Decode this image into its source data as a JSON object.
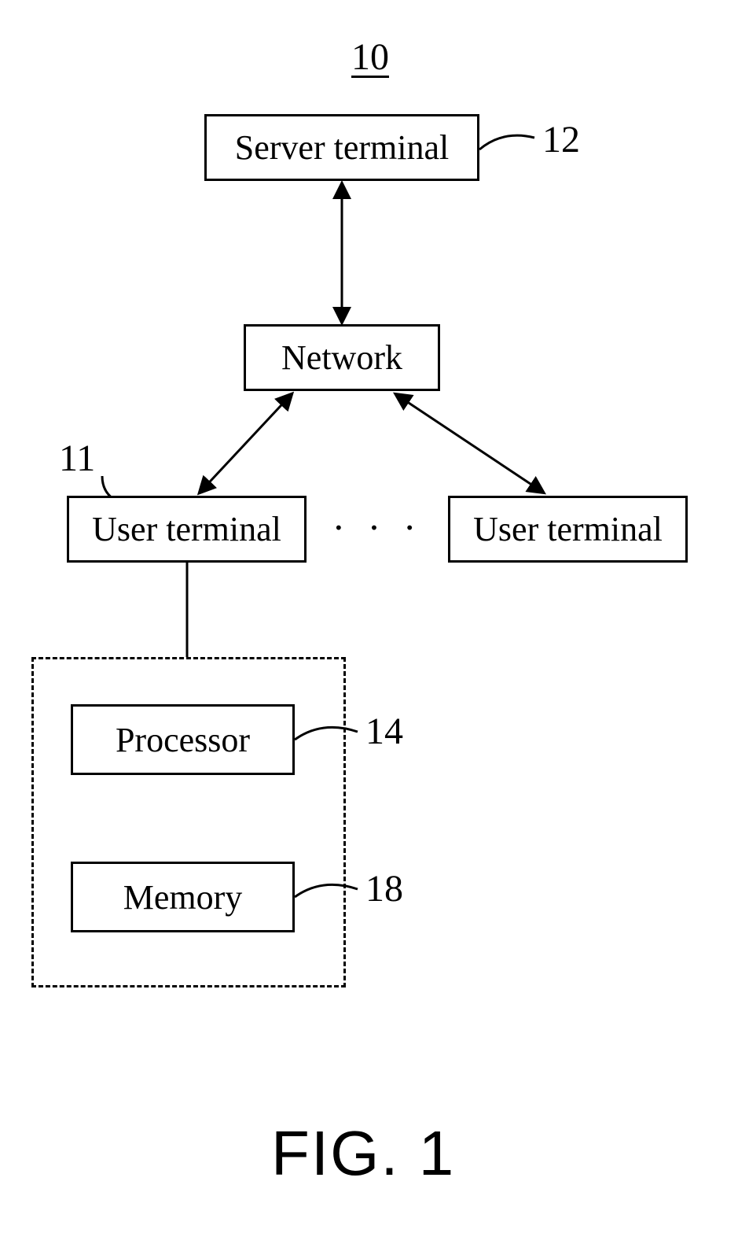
{
  "diagram": {
    "system_ref": "10",
    "boxes": {
      "server": "Server terminal",
      "network": "Network",
      "user_terminal_1": "User terminal",
      "user_terminal_2": "User terminal",
      "processor": "Processor",
      "memory": "Memory"
    },
    "refs": {
      "server": "12",
      "user_terminal": "11",
      "processor": "14",
      "memory": "18"
    },
    "ellipsis": "· · ·",
    "caption": "FIG. 1"
  }
}
